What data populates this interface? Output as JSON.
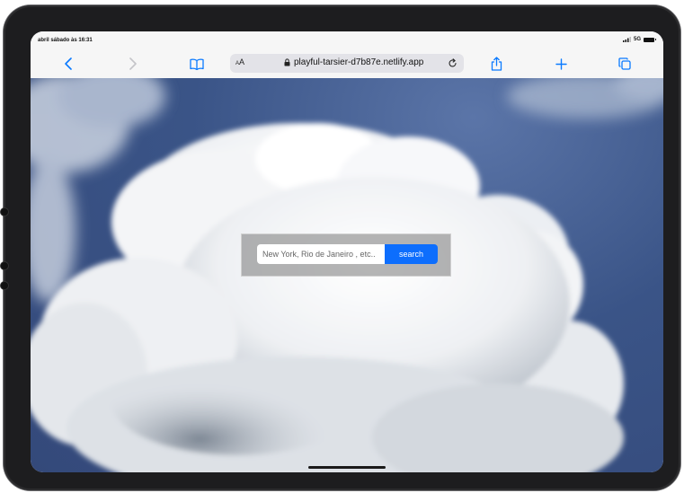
{
  "statusbar": {
    "time": "abril sábado às 16:31",
    "network": "5G"
  },
  "toolbar": {
    "text_size_label_small": "A",
    "text_size_label_large": "A",
    "url": "playful-tarsier-d7b87e.netlify.app"
  },
  "search": {
    "placeholder": "New York, Rio de Janeiro , etc..",
    "button_label": "search"
  },
  "colors": {
    "accent": "#0d6efd",
    "toolbar_icon": "#0a7aff",
    "sky": "#3a5487"
  },
  "icons": [
    "back-icon",
    "forward-icon",
    "bookmarks-icon",
    "lock-icon",
    "reload-icon",
    "share-icon",
    "new-tab-icon",
    "tabs-icon",
    "signal-icon",
    "battery-icon"
  ]
}
